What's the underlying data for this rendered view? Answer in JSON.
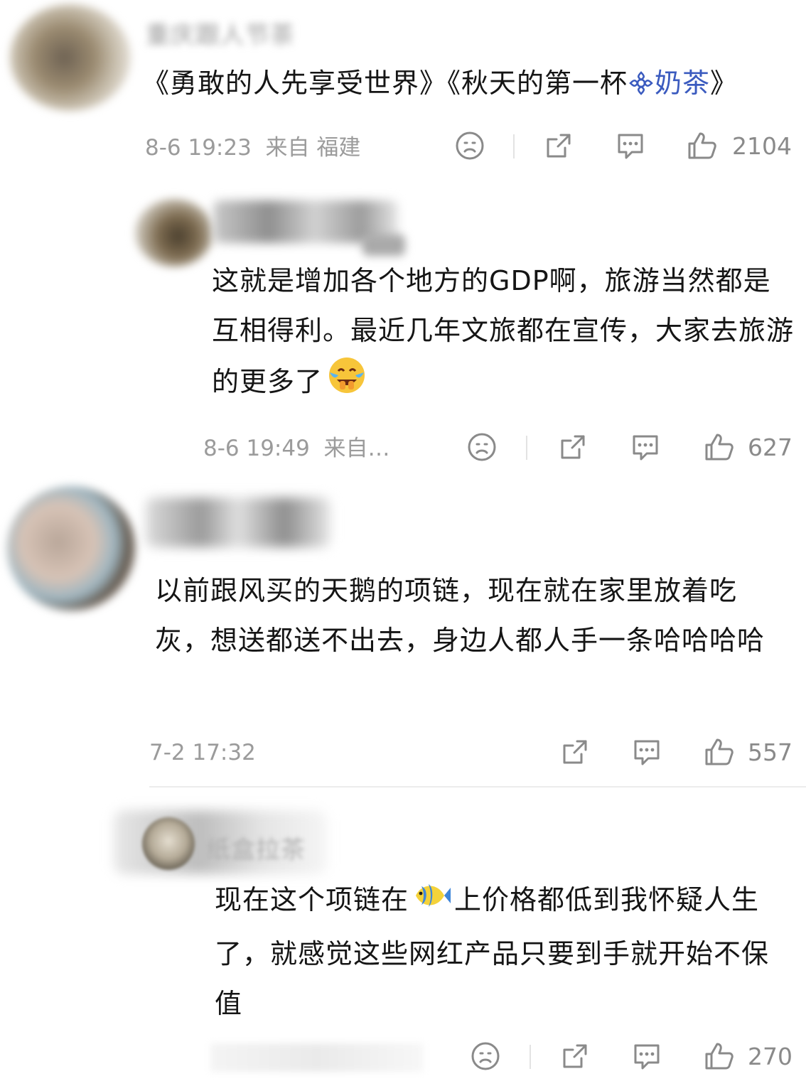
{
  "comments": [
    {
      "user": "重庆跟人节茶",
      "text_prefix": "《勇敢的人先享受世界》《秋天的第一杯",
      "topic_icon": "topic-flower-icon",
      "topic_text": "奶茶",
      "text_suffix": "》",
      "time": "8-6 19:23",
      "location": "来自 福建",
      "likes": "2104"
    },
    {
      "user": "",
      "text": "这就是增加各个地方的GDP啊，旅游当然都是互相得利。最近几年文旅都在宣传，大家去旅游的更多了",
      "emoji": "laughing-crying-emoji",
      "time": "8-6 19:49",
      "location": "来自…",
      "likes": "627"
    },
    {
      "user": "",
      "text": "以前跟风买的天鹅的项链，现在就在家里放着吃灰，想送都送不出去，身边人都人手一条哈哈哈哈",
      "time": "7-2 17:32",
      "likes": "557"
    },
    {
      "user": "纸盒拉茶",
      "text_prefix": "现在这个项链在",
      "emoji": "fish-emoji",
      "text_suffix": "上价格都低到我怀疑人生了，就感觉这些网红产品只要到手就开始不保值",
      "likes": "270"
    }
  ],
  "colors": {
    "text": "#151515",
    "meta": "#9b9b9b",
    "link": "#3b5bbf",
    "icon": "#8a8a8a"
  }
}
